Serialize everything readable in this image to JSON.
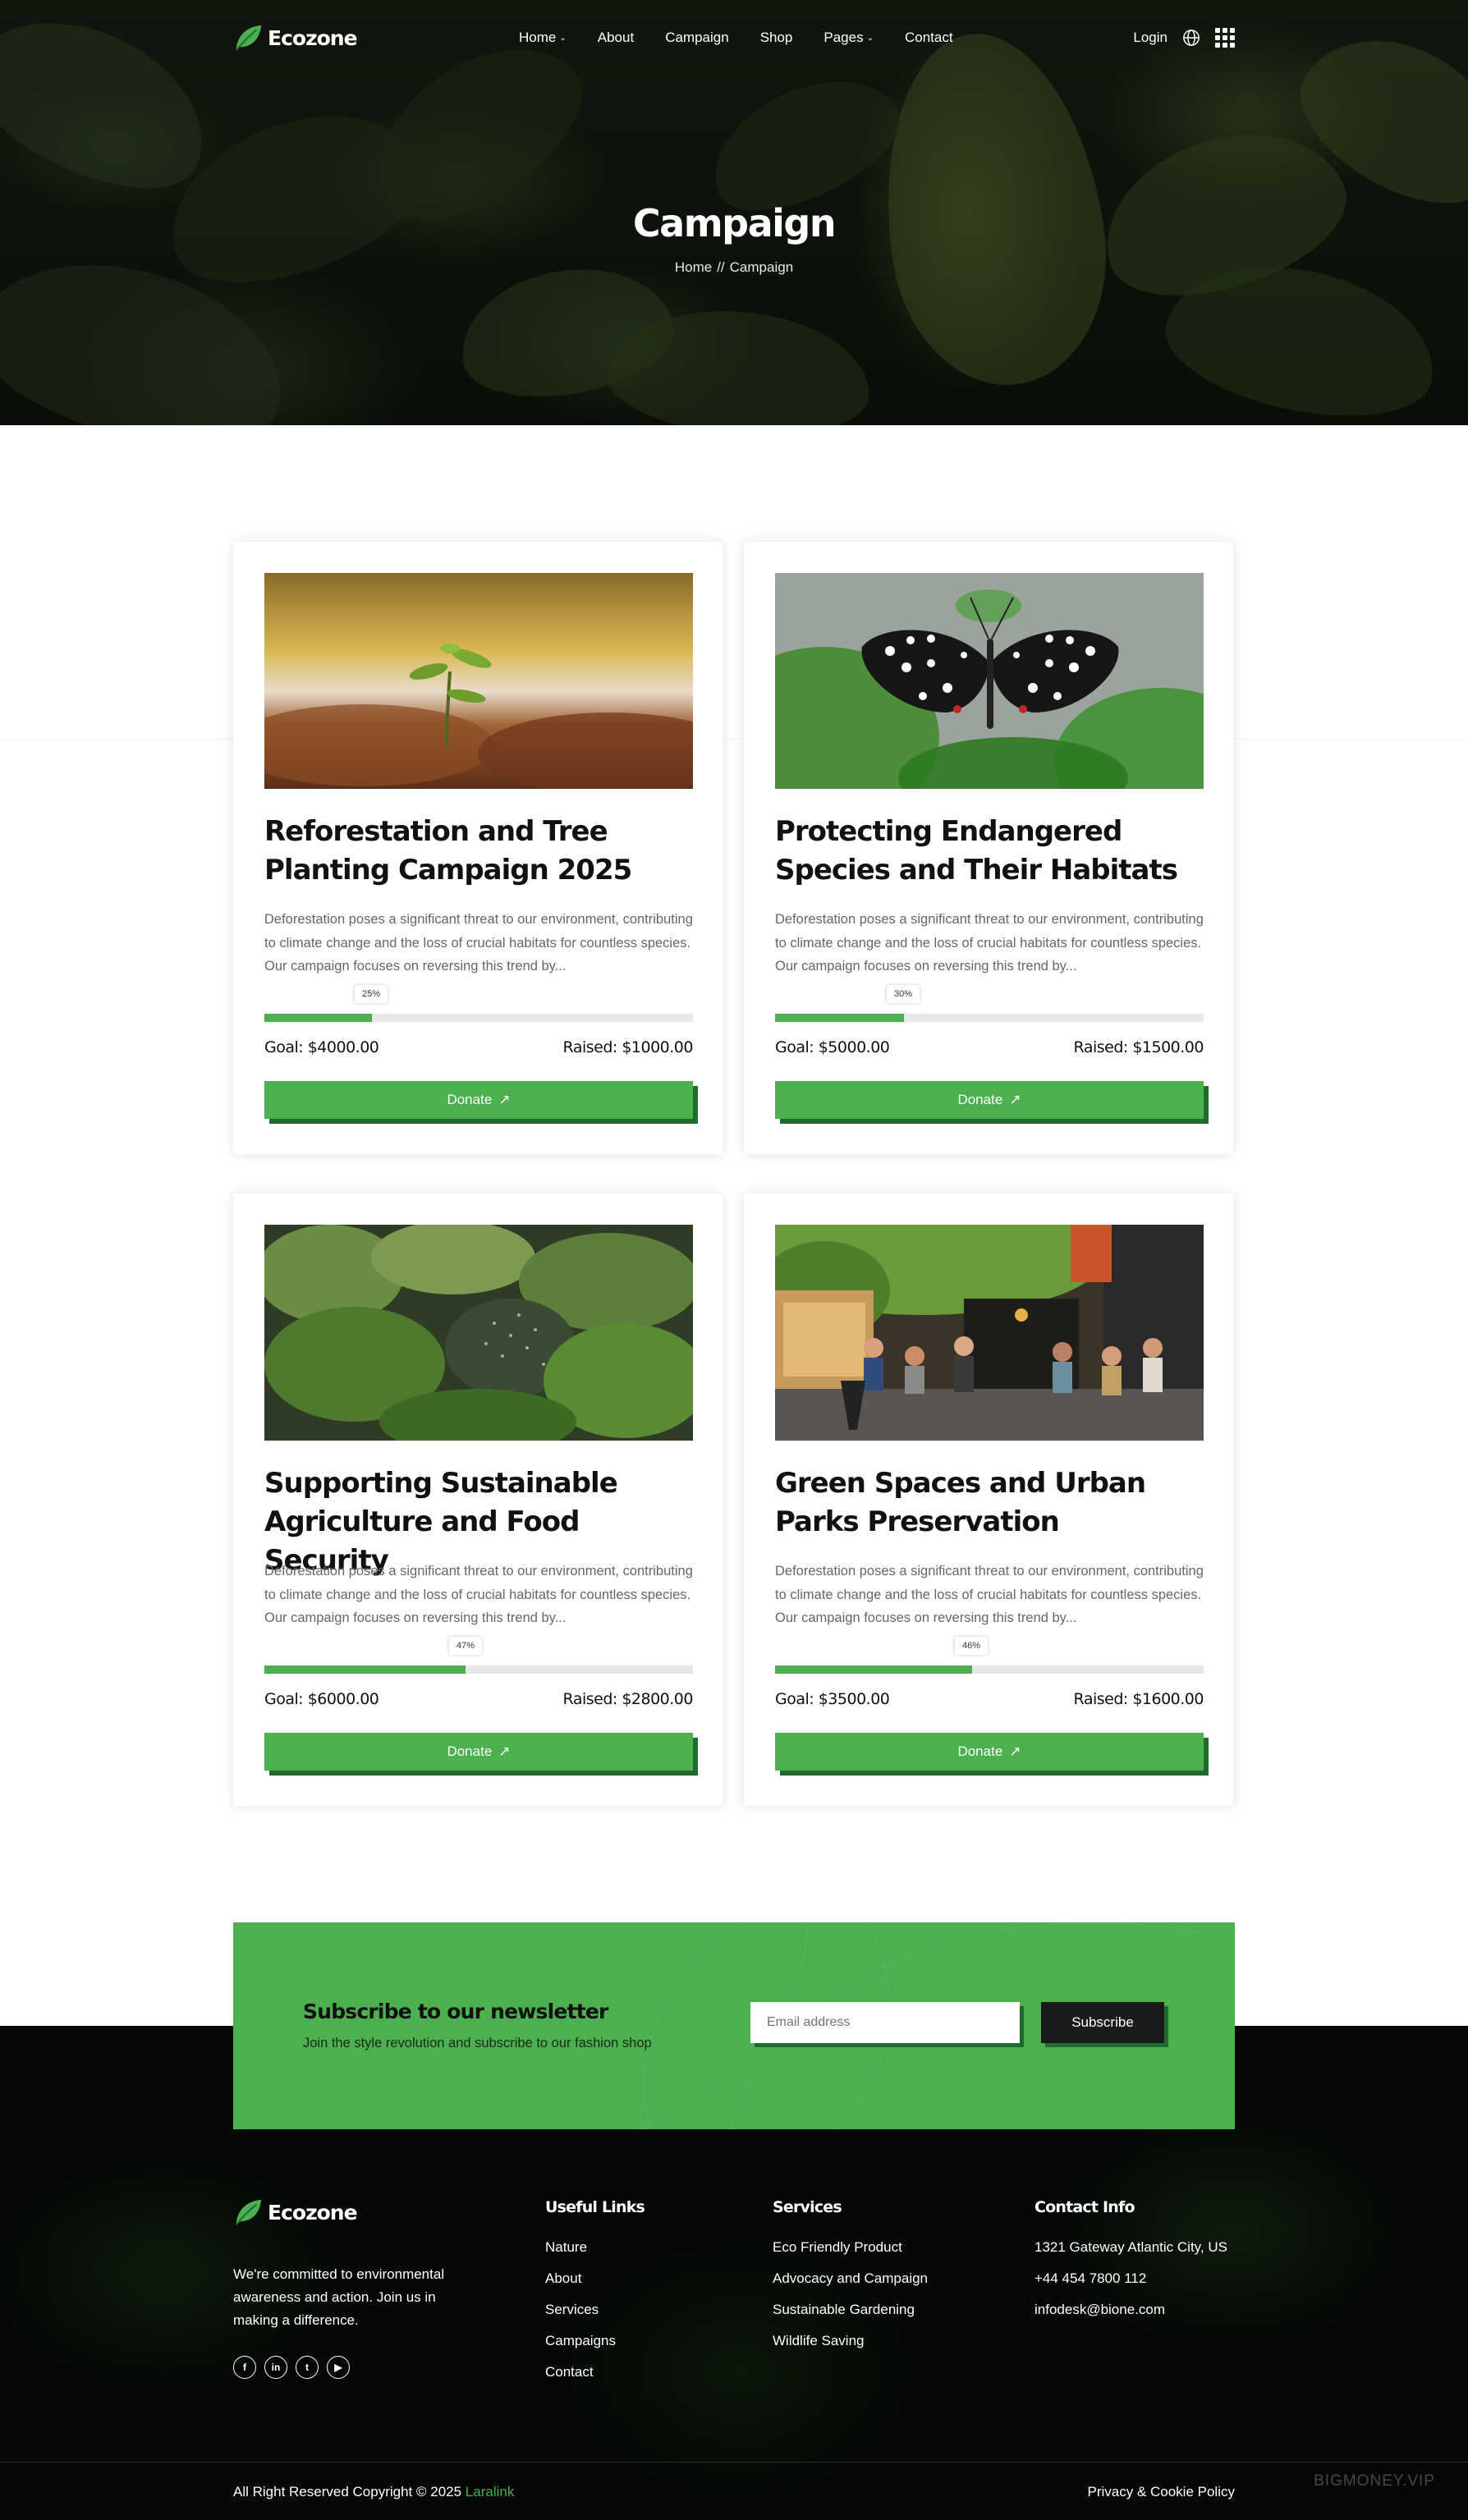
{
  "header": {
    "brand": "Ecozone",
    "nav": [
      {
        "label": "Home",
        "dropdown": true
      },
      {
        "label": "About",
        "dropdown": false
      },
      {
        "label": "Campaign",
        "dropdown": false
      },
      {
        "label": "Shop",
        "dropdown": false
      },
      {
        "label": "Pages",
        "dropdown": true
      },
      {
        "label": "Contact",
        "dropdown": false
      }
    ],
    "login": "Login"
  },
  "hero": {
    "title": "Campaign",
    "breadcrumb": [
      "Home",
      "//",
      "Campaign"
    ]
  },
  "campaigns": [
    {
      "title": "Reforestation and Tree Planting Campaign 2025",
      "description": "Deforestation poses a significant threat to our environment, contributing to climate change and the loss of crucial habitats for countless species. Our campaign focuses on reversing this trend by...",
      "progress_label": "25%",
      "progress": 25,
      "goal": "Goal: $4000.00",
      "raised": "Raised: $1000.00",
      "button": "Donate",
      "image": "seedling"
    },
    {
      "title": "Protecting Endangered Species and Their Habitats",
      "description": "Deforestation poses a significant threat to our environment, contributing to climate change and the loss of crucial habitats for countless species. Our campaign focuses on reversing this trend by...",
      "progress_label": "30%",
      "progress": 30,
      "goal": "Goal: $5000.00",
      "raised": "Raised: $1500.00",
      "button": "Donate",
      "image": "butterfly"
    },
    {
      "title": "Supporting Sustainable Agriculture and Food Security",
      "description": "Deforestation poses a significant threat to our environment, contributing to climate change and the loss of crucial habitats for countless species. Our campaign focuses on reversing this trend by...",
      "progress_label": "47%",
      "progress": 47,
      "goal": "Goal: $6000.00",
      "raised": "Raised: $2800.00",
      "button": "Donate",
      "image": "crops"
    },
    {
      "title": "Green Spaces and Urban Parks Preservation",
      "description": "Deforestation poses a significant threat to our environment, contributing to climate change and the loss of crucial habitats for countless species. Our campaign focuses on reversing this trend by...",
      "progress_label": "46%",
      "progress": 46,
      "goal": "Goal: $3500.00",
      "raised": "Raised: $1600.00",
      "button": "Donate",
      "image": "street-cafe"
    }
  ],
  "newsletter": {
    "title": "Subscribe to our newsletter",
    "subtitle": "Join the style revolution and subscribe to our fashion shop",
    "placeholder": "Email address",
    "button": "Subscribe"
  },
  "footer": {
    "brand": "Ecozone",
    "about": "We're committed to environmental awareness and action. Join us in making a difference.",
    "socials": [
      "facebook-icon",
      "linkedin-icon",
      "twitter-icon",
      "youtube-icon"
    ],
    "useful_links": {
      "title": "Useful Links",
      "items": [
        "Nature",
        "About",
        "Services",
        "Campaigns",
        "Contact"
      ]
    },
    "services": {
      "title": "Services",
      "items": [
        "Eco Friendly Product",
        "Advocacy and Campaign",
        "Sustainable Gardening",
        "Wildlife Saving"
      ]
    },
    "contact": {
      "title": "Contact Info",
      "items": [
        "1321 Gateway Atlantic City, US",
        "+44 454 7800 112",
        "infodesk@bione.com"
      ]
    },
    "copyright": "All Right Reserved Copyright © 2025",
    "copyright_brand": "Laralink",
    "policy": "Privacy & Cookie Policy",
    "watermark": "BIGMONEY.VIP"
  },
  "colors": {
    "accent": "#4caf50",
    "accent_shadow": "#1f6b2d",
    "footer_bg": "#050805"
  }
}
